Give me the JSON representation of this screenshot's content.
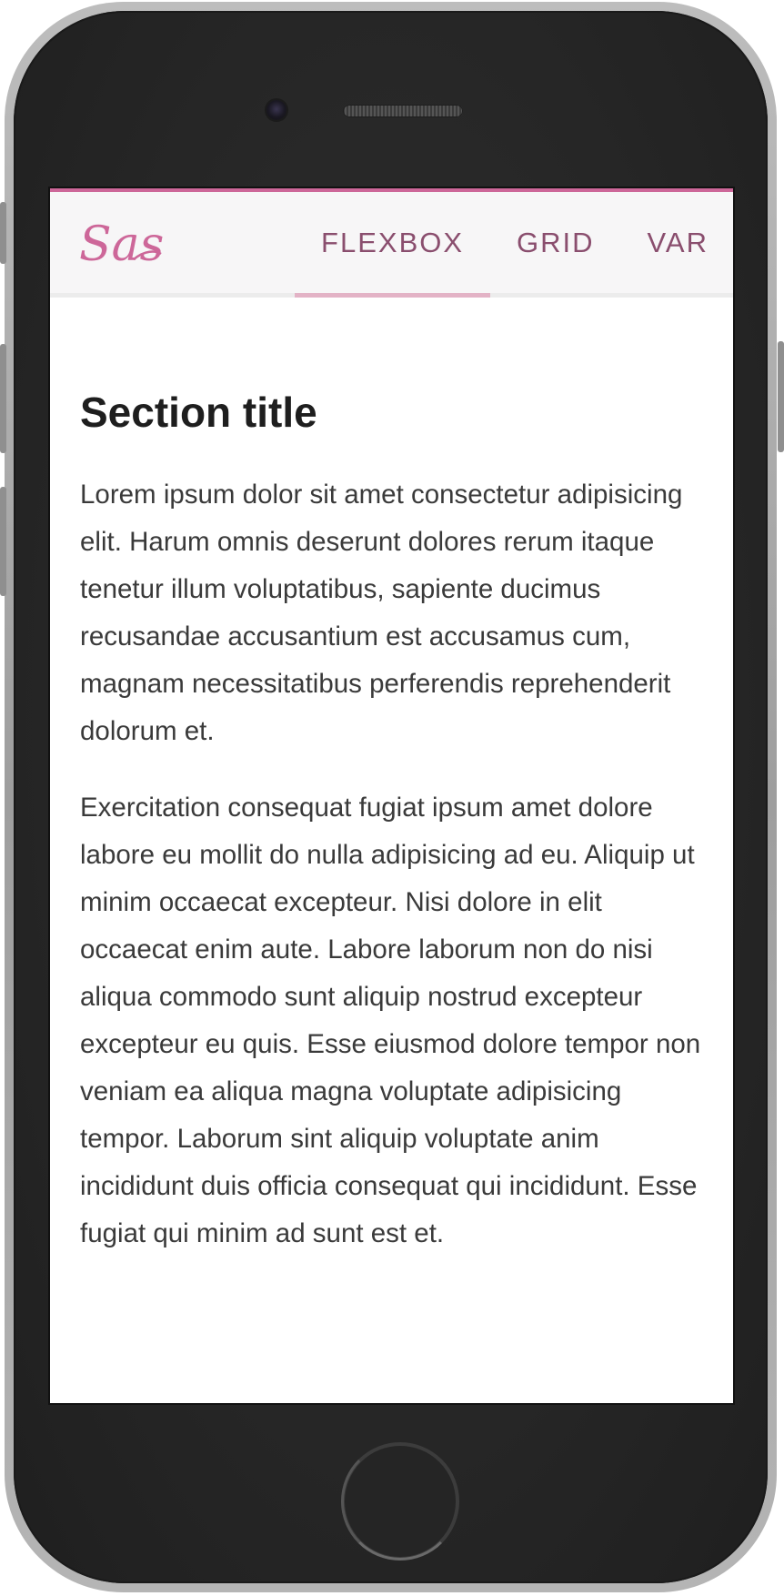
{
  "navbar": {
    "logo_text": "Sass",
    "accent_color": "#cd6799",
    "items": [
      {
        "label": "FLEXBOX",
        "active": true
      },
      {
        "label": "GRID",
        "active": false
      },
      {
        "label": "VAR",
        "active": false
      }
    ]
  },
  "main": {
    "title": "Section title",
    "paragraphs": [
      "Lorem ipsum dolor sit amet consectetur adipisicing elit. Harum omnis deserunt dolores rerum itaque tenetur illum voluptatibus, sapiente ducimus recusandae accusantium est accusamus cum, magnam necessitatibus perferendis reprehenderit dolorum et.",
      "Exercitation consequat fugiat ipsum amet dolore labore eu mollit do nulla adipisicing ad eu. Aliquip ut minim occaecat excepteur. Nisi dolore in elit occaecat enim aute. Labore laborum non do nisi aliqua commodo sunt aliquip nostrud excepteur excepteur eu quis. Esse eiusmod dolore tempor non veniam ea aliqua magna voluptate adipisicing tempor. Laborum sint aliquip voluptate anim incididunt duis officia consequat qui incididunt. Esse fugiat qui minim ad sunt est et."
    ]
  },
  "device": {
    "frame": "phone",
    "body_color": "#262626",
    "bezel_color": "#a8a8a8"
  }
}
